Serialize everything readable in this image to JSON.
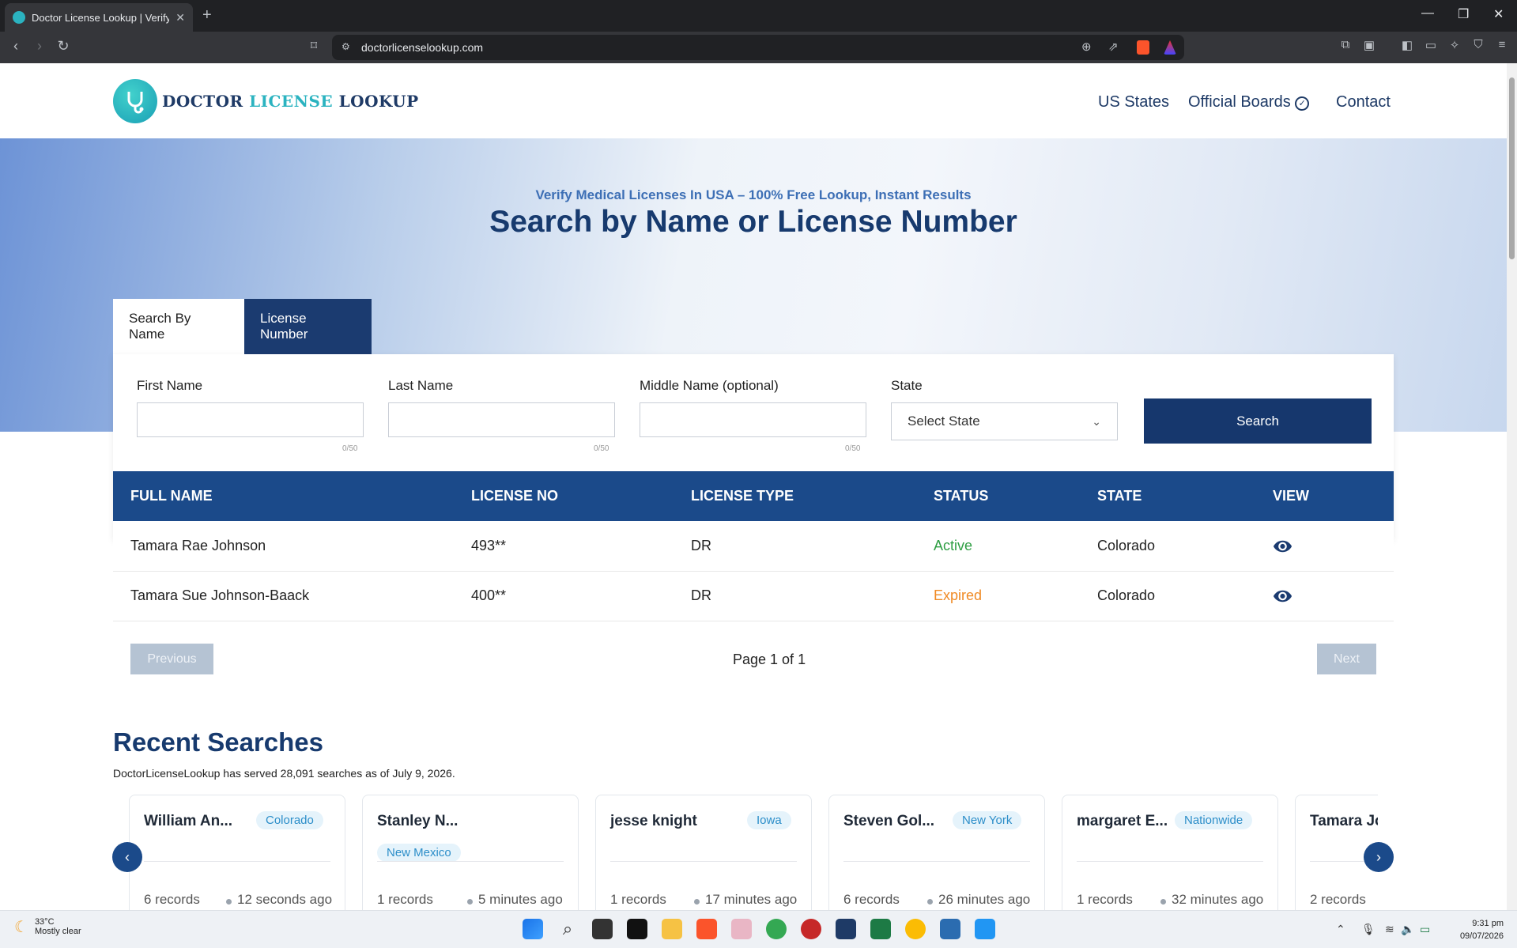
{
  "browser": {
    "tab_title": "Doctor License Lookup | Verify M",
    "url": "doctorlicenselookup.com"
  },
  "site": {
    "logo_part1": "DOCTOR ",
    "logo_part2": "LICENSE",
    "logo_part3": " LOOKUP",
    "nav": [
      "US States",
      "Official Boards",
      "Contact"
    ]
  },
  "hero": {
    "subtitle": "Verify Medical Licenses In USA – 100% Free Lookup, Instant Results",
    "title": "Search by Name or License Number"
  },
  "search_tabs": [
    "Search By Name",
    "License Number"
  ],
  "form": {
    "first_name_label": "First Name",
    "last_name_label": "Last Name",
    "middle_name_label": "Middle Name (optional)",
    "state_label": "State",
    "counter": "0/50",
    "state_value": "Select State",
    "search_button": "Search"
  },
  "table": {
    "headers": [
      "FULL NAME",
      "LICENSE NO",
      "LICENSE TYPE",
      "STATUS",
      "STATE",
      "VIEW"
    ],
    "rows": [
      {
        "name": "Tamara Rae Johnson",
        "license": "493**",
        "type": "DR",
        "status": "Active",
        "status_color": "#2e9e43",
        "state": "Colorado"
      },
      {
        "name": "Tamara Sue Johnson-Baack",
        "license": "400**",
        "type": "DR",
        "status": "Expired",
        "status_color": "#f08a24",
        "state": "Colorado"
      }
    ]
  },
  "pagination": {
    "previous": "Previous",
    "info": "Page 1 of 1",
    "next": "Next"
  },
  "recent": {
    "title": "Recent Searches",
    "subtitle": "DoctorLicenseLookup has served 28,091 searches as of July 9, 2026.",
    "cards": [
      {
        "name": "William An...",
        "state": "Colorado",
        "records": "6 records",
        "ago": "12 seconds ago"
      },
      {
        "name": "Stanley N...",
        "state": "New Mexico",
        "records": "1 records",
        "ago": "5 minutes ago"
      },
      {
        "name": "jesse knight",
        "state": "Iowa",
        "records": "1 records",
        "ago": "17 minutes ago"
      },
      {
        "name": "Steven Gol...",
        "state": "New York",
        "records": "6 records",
        "ago": "26 minutes ago"
      },
      {
        "name": "margaret E...",
        "state": "Nationwide",
        "records": "1 records",
        "ago": "32 minutes ago"
      },
      {
        "name": "Tamara Jo...",
        "state": "",
        "records": "2 records",
        "ago": ""
      }
    ]
  },
  "taskbar": {
    "temp": "33°C",
    "weather": "Mostly clear",
    "time": "9:31 pm",
    "date": "09/07/2026"
  },
  "colors": {
    "primary": "#1b3b70",
    "accent": "#2bb3c0",
    "active": "#2e9e43",
    "expired": "#f08a24"
  }
}
